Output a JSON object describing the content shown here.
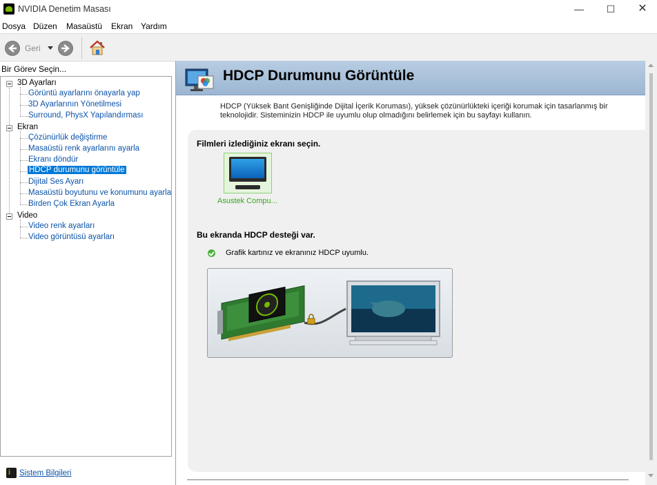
{
  "window": {
    "title": "NVIDIA Denetim Masası",
    "minimize": "—",
    "maximize": "☐",
    "close": "✕"
  },
  "menu": [
    "Dosya",
    "Düzen",
    "Masaüstü",
    "Ekran",
    "Yardım"
  ],
  "toolbar": {
    "back_label": "Geri",
    "back_icon": "back-arrow-icon",
    "forward_icon": "forward-arrow-icon",
    "home_icon": "home-icon"
  },
  "sidebar": {
    "heading": "Bir Görev Seçin...",
    "groups": [
      {
        "label": "3D Ayarları",
        "items": [
          "Görüntü ayarlarını önayarla yap",
          "3D Ayarlarının Yönetilmesi",
          "Surround, PhysX Yapılandırması"
        ]
      },
      {
        "label": "Ekran",
        "items": [
          "Çözünürlük değiştirme",
          "Masaüstü renk ayarlarını ayarla",
          "Ekranı döndür",
          "HDCP durumunu görüntüle",
          "Dijital Ses Ayarı",
          "Masaüstü boyutunu ve konumunu ayarla",
          "Birden Çok Ekran Ayarla"
        ]
      },
      {
        "label": "Video",
        "items": [
          "Video renk ayarları",
          "Video görüntüsü ayarları"
        ]
      }
    ],
    "selected": "HDCP durumunu görüntüle",
    "system_info": "Sistem Bilgileri"
  },
  "main": {
    "title": "HDCP Durumunu Görüntüle",
    "description": "HDCP (Yüksek Bant Genişliğinde Dijital İçerik Koruması), yüksek çözünürlükteki içeriği korumak için tasarlanmış bir teknolojidir. Sisteminizin HDCP ile uyumlu olup olmadığını belirlemek için bu sayfayı kullanın.",
    "select_display_label": "Filmleri izlediğiniz ekranı seçin.",
    "display_name": "Asustek Compu...",
    "support_label": "Bu ekranda HDCP desteği var.",
    "status_text": "Grafik kartınız ve ekranınız HDCP uyumlu."
  },
  "colors": {
    "accent": "#0078d7",
    "link": "#0a52a8",
    "nvidia_green": "#76b900",
    "header_band": "#b8cde2"
  }
}
